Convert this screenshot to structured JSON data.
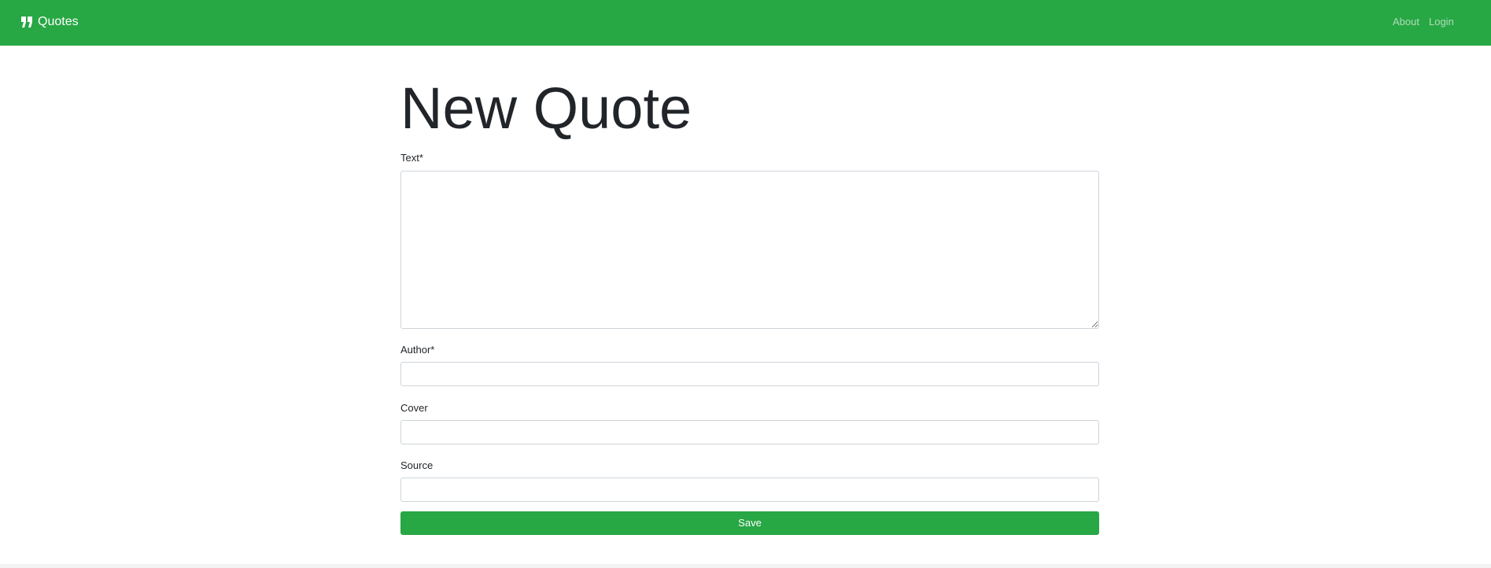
{
  "navbar": {
    "brand_label": "Quotes",
    "brand_icon": "quote-icon",
    "links": [
      {
        "label": "About"
      },
      {
        "label": "Login"
      }
    ],
    "background_color": "#28a745"
  },
  "main": {
    "title": "New Quote",
    "fields": {
      "text": {
        "label": "Text*",
        "value": "",
        "placeholder": ""
      },
      "author": {
        "label": "Author*",
        "value": "",
        "placeholder": ""
      },
      "cover": {
        "label": "Cover",
        "value": "",
        "placeholder": ""
      },
      "source": {
        "label": "Source",
        "value": "",
        "placeholder": ""
      }
    },
    "save_label": "Save"
  }
}
